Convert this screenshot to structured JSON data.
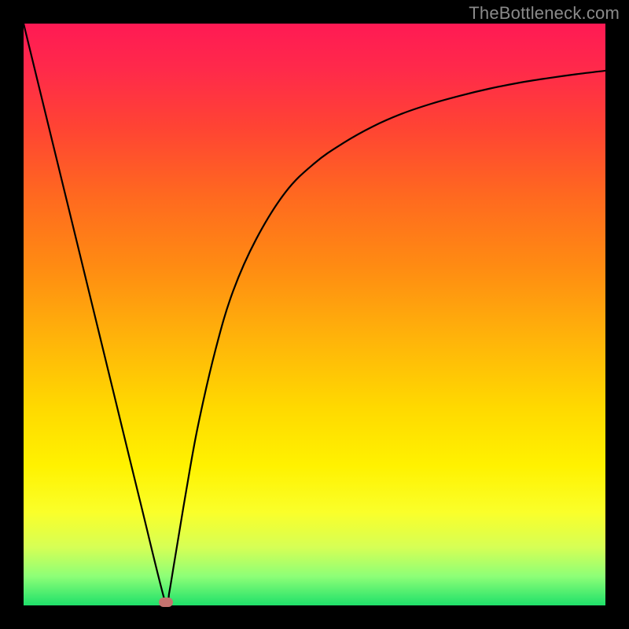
{
  "watermark": "TheBottleneck.com",
  "colors": {
    "frame": "#000000",
    "curve": "#000000",
    "marker": "#c5736f",
    "gradient_top": "#ff1a54",
    "gradient_bottom": "#1fe06a"
  },
  "chart_data": {
    "type": "line",
    "title": "",
    "xlabel": "",
    "ylabel": "",
    "xlim": [
      0,
      100
    ],
    "ylim": [
      0,
      100
    ],
    "grid": false,
    "legend": false,
    "series": [
      {
        "name": "bottleneck-curve",
        "x": [
          0,
          5,
          10,
          15,
          20,
          24.5,
          25,
          26,
          28,
          30,
          33,
          36,
          40,
          45,
          50,
          55,
          60,
          65,
          70,
          75,
          80,
          85,
          90,
          95,
          100
        ],
        "y": [
          100,
          79.5,
          59,
          38.5,
          18,
          0,
          2,
          8,
          20,
          31,
          44,
          54,
          63,
          71,
          76,
          79.5,
          82.3,
          84.5,
          86.2,
          87.6,
          88.8,
          89.8,
          90.6,
          91.3,
          91.9
        ]
      }
    ],
    "marker": {
      "x": 24.5,
      "y": 0
    }
  }
}
